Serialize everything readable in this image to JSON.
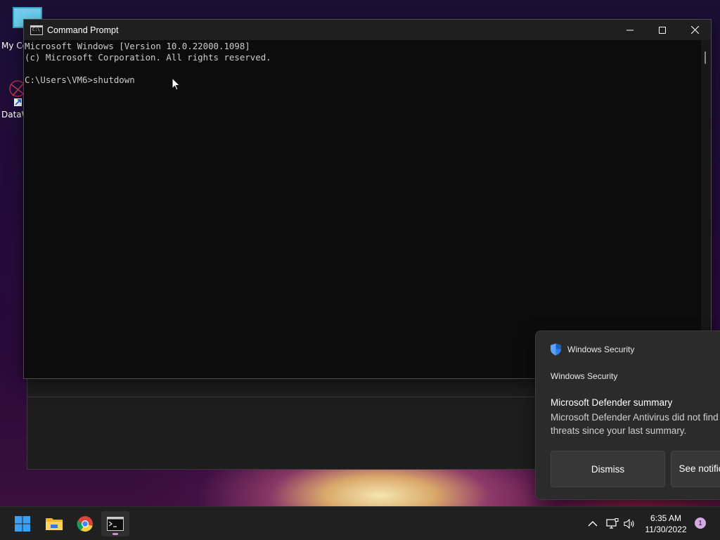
{
  "desktop": {
    "icons": [
      {
        "label": "My Co",
        "icon": "computer-icon"
      },
      {
        "label": "DataW",
        "icon": "datawrapper-shortcut-icon"
      }
    ]
  },
  "cmd_window": {
    "title": "Command Prompt",
    "lines": [
      "Microsoft Windows [Version 10.0.22000.1098]",
      "(c) Microsoft Corporation. All rights reserved.",
      "",
      "C:\\Users\\VM6>shutdown"
    ],
    "app_icon_text": "C:\\"
  },
  "toast": {
    "app_name": "Windows Security",
    "subheader": "Windows Security",
    "title": "Microsoft Defender summary",
    "message": "Microsoft Defender Antivirus did not find threats since your last summary.",
    "dismiss_label": "Dismiss",
    "see_label": "See notifications",
    "accent": "#2f80ed"
  },
  "taskbar": {
    "apps": [
      "start-icon",
      "file-explorer-icon",
      "chrome-icon",
      "command-prompt-icon"
    ],
    "time": "6:35 AM",
    "date": "11/30/2022",
    "notification_count": "1",
    "tray_icons": [
      "chevron-up-icon",
      "network-icon",
      "volume-icon"
    ]
  }
}
